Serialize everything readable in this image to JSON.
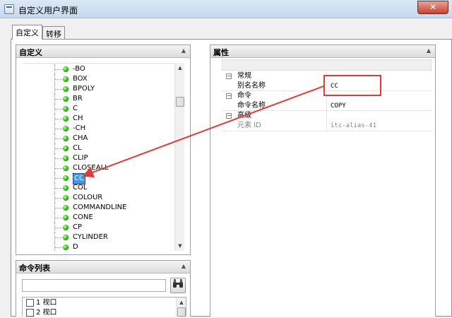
{
  "window": {
    "title": "自定义用户界面",
    "close_symbol": "✕"
  },
  "tabs": [
    {
      "label": "自定义"
    },
    {
      "label": "转移"
    }
  ],
  "custom_panel": {
    "title": "自定义",
    "collapse_symbol": "▲",
    "items": [
      "-BO",
      "BOX",
      "BPOLY",
      "BR",
      "C",
      "CH",
      "-CH",
      "CHA",
      "CL",
      "CLIP",
      "CLOSEALL",
      "CC",
      "COL",
      "COLOUR",
      "COMMANDLINE",
      "CONE",
      "CP",
      "CYLINDER",
      "D"
    ],
    "selected": "CC"
  },
  "command_list": {
    "title": "命令列表",
    "collapse_symbol": "▲",
    "search_placeholder": "",
    "search_icon": "binoculars-icon",
    "items": [
      "1 视口",
      "2 视口"
    ]
  },
  "properties": {
    "title": "属性",
    "collapse_symbol": "▲",
    "groups": [
      {
        "name": "常规",
        "toggle": "⊟",
        "rows": [
          {
            "name": "别名名称",
            "value": "CC"
          }
        ]
      },
      {
        "name": "命令",
        "toggle": "⊟",
        "rows": [
          {
            "name": "命令名称",
            "value": "COPY"
          }
        ]
      },
      {
        "name": "高级",
        "toggle": "⊟",
        "rows": [
          {
            "name": "元素 ID",
            "value": "itc-alias-41"
          }
        ]
      }
    ]
  },
  "accent_colors": {
    "selection": "#3399ff",
    "annotation": "#e53935",
    "status_dot": "#19b400"
  }
}
